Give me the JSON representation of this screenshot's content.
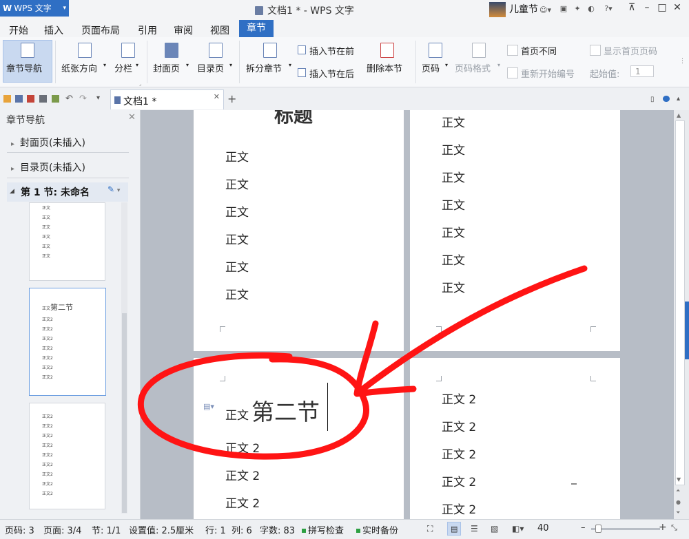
{
  "titlebar": {
    "app_name": "WPS 文字",
    "title": "文档1 * - WPS 文字",
    "user": "儿童节"
  },
  "menu": [
    "开始",
    "插入",
    "页面布局",
    "引用",
    "审阅",
    "视图"
  ],
  "active_tab": "章节",
  "ribbon": {
    "nav": "章节导航",
    "orientation": "纸张方向",
    "columns": "分栏",
    "cover": "封面页",
    "toc": "目录页",
    "split": "拆分章节",
    "insert_before": "插入节在前",
    "insert_after": "插入节在后",
    "delete_section": "删除本节",
    "page_number": "页码",
    "page_format": "页码格式",
    "first_page_diff": "首页不同",
    "show_first_page_num": "显示首页页码",
    "restart_numbering": "重新开始编号",
    "start_value_label": "起始值:",
    "start_value": "1"
  },
  "doctab": {
    "label": "文档1 *"
  },
  "sidebar": {
    "title": "章节导航",
    "items": [
      "封面页(未插入)",
      "目录页(未插入)"
    ],
    "section": "第 1 节: 未命名",
    "thumb_second_heading": "第二节",
    "thumb_body1": "正文",
    "thumb_body2": "正文2"
  },
  "document": {
    "title_partial": "标题",
    "body": "正文",
    "body2": "正文 2",
    "section2_heading": "第二节"
  },
  "status": {
    "page_num": "页码: 3",
    "page": "页面: 3/4",
    "section": "节: 1/1",
    "setting": "设置值: 2.5厘米",
    "row": "行: 1",
    "col": "列: 6",
    "chars": "字数: 83",
    "spell": "拼写检查",
    "backup": "实时备份",
    "zoom": "40"
  },
  "colors": {
    "accent": "#2f6fc4",
    "annotation": "#ff1414"
  }
}
